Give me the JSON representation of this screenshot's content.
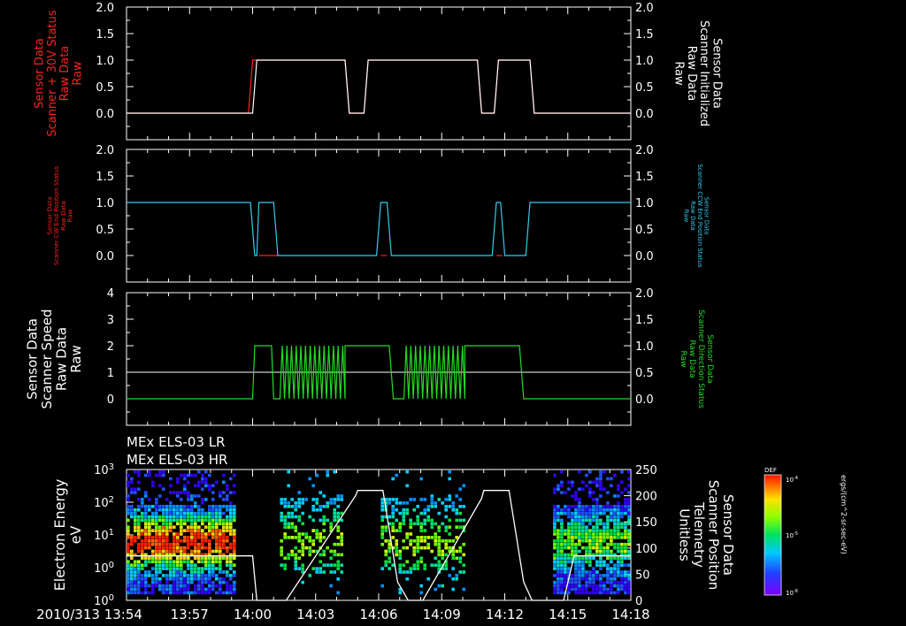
{
  "colors": {
    "white": "#ffffff",
    "red": "#ff2020",
    "cyan": "#33ccee",
    "green": "#22dd22",
    "background": "#000000"
  },
  "time_axis": {
    "start": "13:54",
    "end": "14:18",
    "tick_labels": [
      "2010/313 13:54",
      "13:57",
      "14:00",
      "14:03",
      "14:06",
      "14:09",
      "14:12",
      "14:15",
      "14:18"
    ],
    "tick_values_min": [
      0,
      3,
      6,
      9,
      12,
      15,
      18,
      21,
      24
    ]
  },
  "chart_data": [
    {
      "type": "line",
      "left_label": [
        "Sensor Data",
        "Scanner + 30V Status",
        "Raw Data",
        "Raw"
      ],
      "right_label": [
        "Sensor Data",
        "Scanner Initialized",
        "Raw Data",
        "Raw"
      ],
      "left_ticks": [
        "2.0",
        "1.5",
        "1.0",
        "0.5",
        "0.0"
      ],
      "right_ticks": [
        "2.0",
        "1.5",
        "1.0",
        "0.5",
        "0.0"
      ],
      "ylim": [
        -0.5,
        2.0
      ],
      "series": [
        {
          "color": "red",
          "points": [
            [
              0,
              0
            ],
            [
              5.8,
              0
            ],
            [
              6.0,
              1
            ],
            [
              10.4,
              1
            ],
            [
              10.6,
              0
            ],
            [
              11.3,
              0
            ],
            [
              11.5,
              1
            ],
            [
              16.7,
              1
            ],
            [
              16.9,
              0
            ],
            [
              17.5,
              0
            ],
            [
              17.7,
              1
            ],
            [
              19.2,
              1
            ],
            [
              19.4,
              0
            ],
            [
              24,
              0
            ]
          ]
        },
        {
          "color": "white",
          "points": [
            [
              0,
              0
            ],
            [
              6.0,
              0
            ],
            [
              6.2,
              1
            ],
            [
              10.4,
              1
            ],
            [
              10.6,
              0
            ],
            [
              11.3,
              0
            ],
            [
              11.5,
              1
            ],
            [
              16.7,
              1
            ],
            [
              16.9,
              0
            ],
            [
              17.5,
              0
            ],
            [
              17.7,
              1
            ],
            [
              19.2,
              1
            ],
            [
              19.4,
              0
            ],
            [
              24,
              0
            ]
          ]
        }
      ]
    },
    {
      "type": "line",
      "left_label": [
        "Sensor Data",
        "Scanner CW End Position Status",
        "Raw Data",
        "Raw"
      ],
      "right_label": [
        "Sensor Data",
        "Scanner CCW End Position Status",
        "Raw Data",
        "Raw"
      ],
      "left_ticks": [
        "2.0",
        "1.5",
        "1.0",
        "0.5",
        "0.0"
      ],
      "right_ticks": [
        "2.0",
        "1.5",
        "1.0",
        "0.5",
        "0.0"
      ],
      "ylim": [
        -0.5,
        2.0
      ],
      "series": [
        {
          "color": "red",
          "points": [
            [
              6.3,
              0
            ],
            [
              7.2,
              0
            ],
            [
              12.1,
              0
            ],
            [
              12.4,
              0
            ],
            [
              17.6,
              0
            ],
            [
              17.9,
              0
            ]
          ]
        },
        {
          "color": "cyan",
          "points": [
            [
              0,
              1
            ],
            [
              5.9,
              1
            ],
            [
              6.1,
              0
            ],
            [
              6.2,
              0
            ],
            [
              6.3,
              1
            ],
            [
              7.0,
              1
            ],
            [
              7.2,
              0
            ],
            [
              11.9,
              0
            ],
            [
              12.1,
              1
            ],
            [
              12.4,
              1
            ],
            [
              12.6,
              0
            ],
            [
              17.4,
              0
            ],
            [
              17.6,
              1
            ],
            [
              17.8,
              1
            ],
            [
              18.0,
              0
            ],
            [
              19.0,
              0
            ],
            [
              19.2,
              1
            ],
            [
              24,
              1
            ]
          ]
        }
      ]
    },
    {
      "type": "line",
      "left_label": [
        "Sensor Data",
        "Scanner Speed",
        "Raw Data",
        "Raw"
      ],
      "right_label": [
        "Sensor Data",
        "Scanner Direction Status",
        "Raw Data",
        "Raw"
      ],
      "left_ticks": [
        "4",
        "3",
        "2",
        "1",
        "0"
      ],
      "right_ticks": [
        "2.0",
        "1.5",
        "1.0",
        "0.5",
        "0.0"
      ],
      "ylim": [
        -1,
        4
      ],
      "white_level": 1,
      "series": [
        {
          "color": "green",
          "segments": [
            {
              "type": "flat",
              "points": [
                [
                  0,
                  0
                ],
                [
                  6.0,
                  0
                ],
                [
                  6.1,
                  2
                ],
                [
                  6.9,
                  2
                ],
                [
                  7.0,
                  0
                ],
                [
                  7.3,
                  0
                ]
              ]
            },
            {
              "type": "osc",
              "start": 7.3,
              "end": 10.4,
              "count": 14
            },
            {
              "type": "flat",
              "points": [
                [
                  10.4,
                  2
                ],
                [
                  12.5,
                  2
                ],
                [
                  12.7,
                  0
                ],
                [
                  13.2,
                  0
                ]
              ]
            },
            {
              "type": "osc",
              "start": 13.2,
              "end": 16.1,
              "count": 13
            },
            {
              "type": "flat",
              "points": [
                [
                  16.1,
                  2
                ],
                [
                  18.7,
                  2
                ],
                [
                  18.9,
                  0
                ],
                [
                  24,
                  0
                ]
              ]
            }
          ]
        }
      ]
    },
    {
      "type": "heatmap",
      "title_lines": [
        "MEx ELS-03 LR",
        "MEx ELS-03 HR"
      ],
      "left_label": [
        "Electron Energy",
        "eV"
      ],
      "right_label": [
        "Sensor Data",
        "Scanner Position",
        "Telemetry",
        "Unitless"
      ],
      "left_ticks": [
        "10^3",
        "10^2",
        "10^1",
        "10^0"
      ],
      "right_ticks": [
        "250",
        "200",
        "150",
        "100",
        "50",
        "0"
      ],
      "ylim_log": [
        0,
        3
      ],
      "ylim_right": [
        0,
        250
      ],
      "colorbar": {
        "label": "DEF",
        "unit": "ergs/(cm^2-sr-sec-eV)",
        "ticks": [
          "10^-4",
          "10^-5",
          "10^-6"
        ]
      },
      "scanner_position": [
        [
          0,
          85
        ],
        [
          6.0,
          85
        ],
        [
          6.2,
          0
        ],
        [
          7.6,
          0
        ],
        [
          10.9,
          200
        ],
        [
          11.0,
          210
        ],
        [
          12.2,
          210
        ],
        [
          12.9,
          35
        ],
        [
          13.4,
          0
        ],
        [
          14.1,
          0
        ],
        [
          16.9,
          195
        ],
        [
          17.0,
          210
        ],
        [
          18.2,
          210
        ],
        [
          18.9,
          35
        ],
        [
          19.3,
          0
        ],
        [
          20.8,
          0
        ],
        [
          21.3,
          85
        ],
        [
          24,
          85
        ]
      ]
    }
  ]
}
